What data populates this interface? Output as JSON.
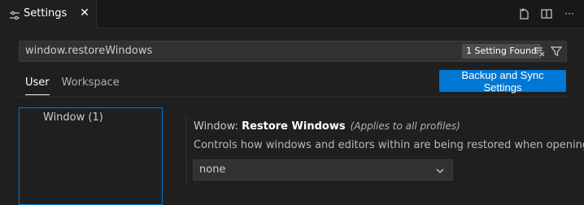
{
  "tab": {
    "label": "Settings",
    "close": "✕",
    "icon": "settings-sliders-icon"
  },
  "toolbar": {
    "actions": [
      "open-json-icon",
      "split-editor-icon",
      "more-actions-icon"
    ],
    "more": "···"
  },
  "search": {
    "value": "window.restoreWindows",
    "result_badge": "1 Setting Found"
  },
  "scopes": {
    "user": "User",
    "workspace": "Workspace"
  },
  "backup_button": "Backup and Sync Settings",
  "toc": {
    "item": "Window (1)"
  },
  "setting": {
    "category": "Window: ",
    "name": "Restore Windows",
    "scope_note": "(Applies to all profiles)",
    "description": "Controls how windows and editors within are being restored when opening.",
    "selected_value": "none"
  },
  "colors": {
    "accent": "#0078d4",
    "background": "#1f1f1f",
    "tabbar": "#181818",
    "input": "#313131"
  }
}
